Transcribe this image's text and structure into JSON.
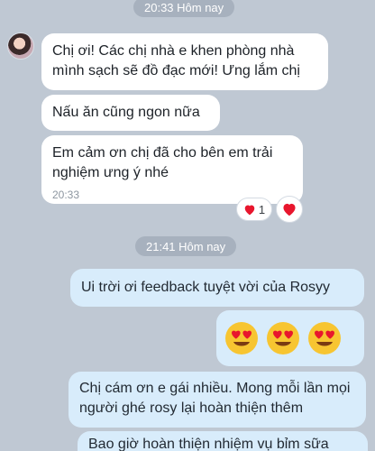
{
  "conversation": {
    "separator_top": "20:33 Hôm nay",
    "separator_mid": "21:41 Hôm nay",
    "incoming": [
      {
        "text": "Chị ơi! Các chị nhà e khen phòng nhà mình sạch sẽ đồ đạc mới! Ưng lắm chị"
      },
      {
        "text": "Nấu ăn cũng ngon nữa"
      },
      {
        "text": "Em cảm ơn chị đã cho bên em trải nghiệm ưng ý nhé",
        "time": "20:33"
      }
    ],
    "reactions": {
      "icon": "heart-icon",
      "count": "1",
      "color": "#e8162d"
    },
    "outgoing": [
      {
        "text": "Ui trời ơi feedback tuyệt vời của Rosyy"
      },
      {
        "emoji": "heart-eyes-emoji",
        "count": 3
      },
      {
        "text": "Chị cám ơn e gái nhiều. Mong mỗi lần mọi người ghé rosy lại hoàn thiện thêm"
      },
      {
        "text": "Bao giờ hoàn thiện nhiệm vụ bỉm sữa"
      }
    ]
  },
  "colors": {
    "background": "#bfc8d3",
    "incoming_bubble": "#ffffff",
    "outgoing_bubble": "#d8ecfb",
    "time_pill": "#a7b1be"
  }
}
